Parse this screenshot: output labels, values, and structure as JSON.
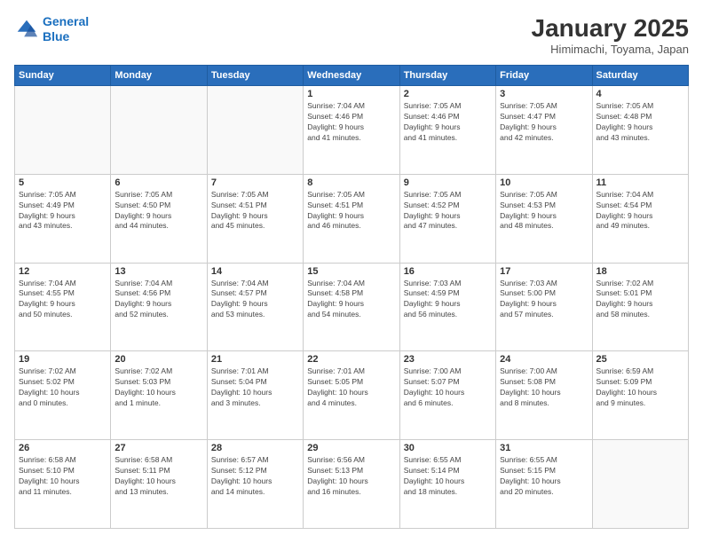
{
  "header": {
    "logo_line1": "General",
    "logo_line2": "Blue",
    "month_title": "January 2025",
    "location": "Himimachi, Toyama, Japan"
  },
  "weekdays": [
    "Sunday",
    "Monday",
    "Tuesday",
    "Wednesday",
    "Thursday",
    "Friday",
    "Saturday"
  ],
  "weeks": [
    [
      {
        "day": "",
        "info": ""
      },
      {
        "day": "",
        "info": ""
      },
      {
        "day": "",
        "info": ""
      },
      {
        "day": "1",
        "info": "Sunrise: 7:04 AM\nSunset: 4:46 PM\nDaylight: 9 hours\nand 41 minutes."
      },
      {
        "day": "2",
        "info": "Sunrise: 7:05 AM\nSunset: 4:46 PM\nDaylight: 9 hours\nand 41 minutes."
      },
      {
        "day": "3",
        "info": "Sunrise: 7:05 AM\nSunset: 4:47 PM\nDaylight: 9 hours\nand 42 minutes."
      },
      {
        "day": "4",
        "info": "Sunrise: 7:05 AM\nSunset: 4:48 PM\nDaylight: 9 hours\nand 43 minutes."
      }
    ],
    [
      {
        "day": "5",
        "info": "Sunrise: 7:05 AM\nSunset: 4:49 PM\nDaylight: 9 hours\nand 43 minutes."
      },
      {
        "day": "6",
        "info": "Sunrise: 7:05 AM\nSunset: 4:50 PM\nDaylight: 9 hours\nand 44 minutes."
      },
      {
        "day": "7",
        "info": "Sunrise: 7:05 AM\nSunset: 4:51 PM\nDaylight: 9 hours\nand 45 minutes."
      },
      {
        "day": "8",
        "info": "Sunrise: 7:05 AM\nSunset: 4:51 PM\nDaylight: 9 hours\nand 46 minutes."
      },
      {
        "day": "9",
        "info": "Sunrise: 7:05 AM\nSunset: 4:52 PM\nDaylight: 9 hours\nand 47 minutes."
      },
      {
        "day": "10",
        "info": "Sunrise: 7:05 AM\nSunset: 4:53 PM\nDaylight: 9 hours\nand 48 minutes."
      },
      {
        "day": "11",
        "info": "Sunrise: 7:04 AM\nSunset: 4:54 PM\nDaylight: 9 hours\nand 49 minutes."
      }
    ],
    [
      {
        "day": "12",
        "info": "Sunrise: 7:04 AM\nSunset: 4:55 PM\nDaylight: 9 hours\nand 50 minutes."
      },
      {
        "day": "13",
        "info": "Sunrise: 7:04 AM\nSunset: 4:56 PM\nDaylight: 9 hours\nand 52 minutes."
      },
      {
        "day": "14",
        "info": "Sunrise: 7:04 AM\nSunset: 4:57 PM\nDaylight: 9 hours\nand 53 minutes."
      },
      {
        "day": "15",
        "info": "Sunrise: 7:04 AM\nSunset: 4:58 PM\nDaylight: 9 hours\nand 54 minutes."
      },
      {
        "day": "16",
        "info": "Sunrise: 7:03 AM\nSunset: 4:59 PM\nDaylight: 9 hours\nand 56 minutes."
      },
      {
        "day": "17",
        "info": "Sunrise: 7:03 AM\nSunset: 5:00 PM\nDaylight: 9 hours\nand 57 minutes."
      },
      {
        "day": "18",
        "info": "Sunrise: 7:02 AM\nSunset: 5:01 PM\nDaylight: 9 hours\nand 58 minutes."
      }
    ],
    [
      {
        "day": "19",
        "info": "Sunrise: 7:02 AM\nSunset: 5:02 PM\nDaylight: 10 hours\nand 0 minutes."
      },
      {
        "day": "20",
        "info": "Sunrise: 7:02 AM\nSunset: 5:03 PM\nDaylight: 10 hours\nand 1 minute."
      },
      {
        "day": "21",
        "info": "Sunrise: 7:01 AM\nSunset: 5:04 PM\nDaylight: 10 hours\nand 3 minutes."
      },
      {
        "day": "22",
        "info": "Sunrise: 7:01 AM\nSunset: 5:05 PM\nDaylight: 10 hours\nand 4 minutes."
      },
      {
        "day": "23",
        "info": "Sunrise: 7:00 AM\nSunset: 5:07 PM\nDaylight: 10 hours\nand 6 minutes."
      },
      {
        "day": "24",
        "info": "Sunrise: 7:00 AM\nSunset: 5:08 PM\nDaylight: 10 hours\nand 8 minutes."
      },
      {
        "day": "25",
        "info": "Sunrise: 6:59 AM\nSunset: 5:09 PM\nDaylight: 10 hours\nand 9 minutes."
      }
    ],
    [
      {
        "day": "26",
        "info": "Sunrise: 6:58 AM\nSunset: 5:10 PM\nDaylight: 10 hours\nand 11 minutes."
      },
      {
        "day": "27",
        "info": "Sunrise: 6:58 AM\nSunset: 5:11 PM\nDaylight: 10 hours\nand 13 minutes."
      },
      {
        "day": "28",
        "info": "Sunrise: 6:57 AM\nSunset: 5:12 PM\nDaylight: 10 hours\nand 14 minutes."
      },
      {
        "day": "29",
        "info": "Sunrise: 6:56 AM\nSunset: 5:13 PM\nDaylight: 10 hours\nand 16 minutes."
      },
      {
        "day": "30",
        "info": "Sunrise: 6:55 AM\nSunset: 5:14 PM\nDaylight: 10 hours\nand 18 minutes."
      },
      {
        "day": "31",
        "info": "Sunrise: 6:55 AM\nSunset: 5:15 PM\nDaylight: 10 hours\nand 20 minutes."
      },
      {
        "day": "",
        "info": ""
      }
    ]
  ]
}
